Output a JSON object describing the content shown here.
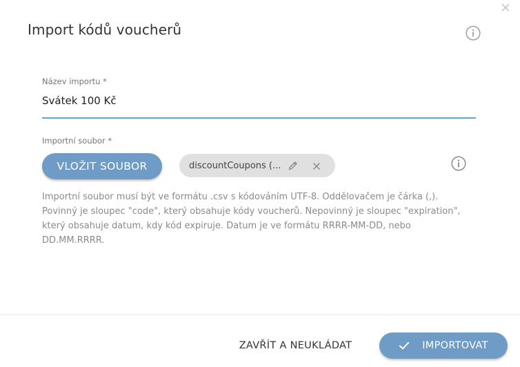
{
  "dialog": {
    "title": "Import kódů voucherů",
    "close_icon": "close-icon",
    "info_icon": "info-icon"
  },
  "form": {
    "name_label": "Název importu *",
    "name_value": "Svátek 100 Kč",
    "file_label": "Importní soubor *",
    "upload_button": "VLOŽIT SOUBOR",
    "file_chip": {
      "filename": "discountCoupons (...",
      "edit_icon": "pencil-icon",
      "remove_icon": "close-icon"
    },
    "help_text": "Importní soubor musí být ve formátu .csv s kódováním UTF-8. Oddělovačem je čárka (,). Povinný je sloupec \"code\", který obsahuje kódy voucherů. Nepovinný je sloupec \"expiration\", který obsahuje datum, kdy kód expiruje. Datum je ve formátu RRRR-MM-DD, nebo DD.MM.RRRR."
  },
  "footer": {
    "cancel_label": "ZAVŘÍT A NEUKLÁDAT",
    "import_label": "IMPORTOVAT",
    "import_icon": "check-icon"
  },
  "colors": {
    "primary": "#6e9cc6",
    "underline": "#5ea4d6",
    "chip_bg": "#e0e0e0"
  }
}
